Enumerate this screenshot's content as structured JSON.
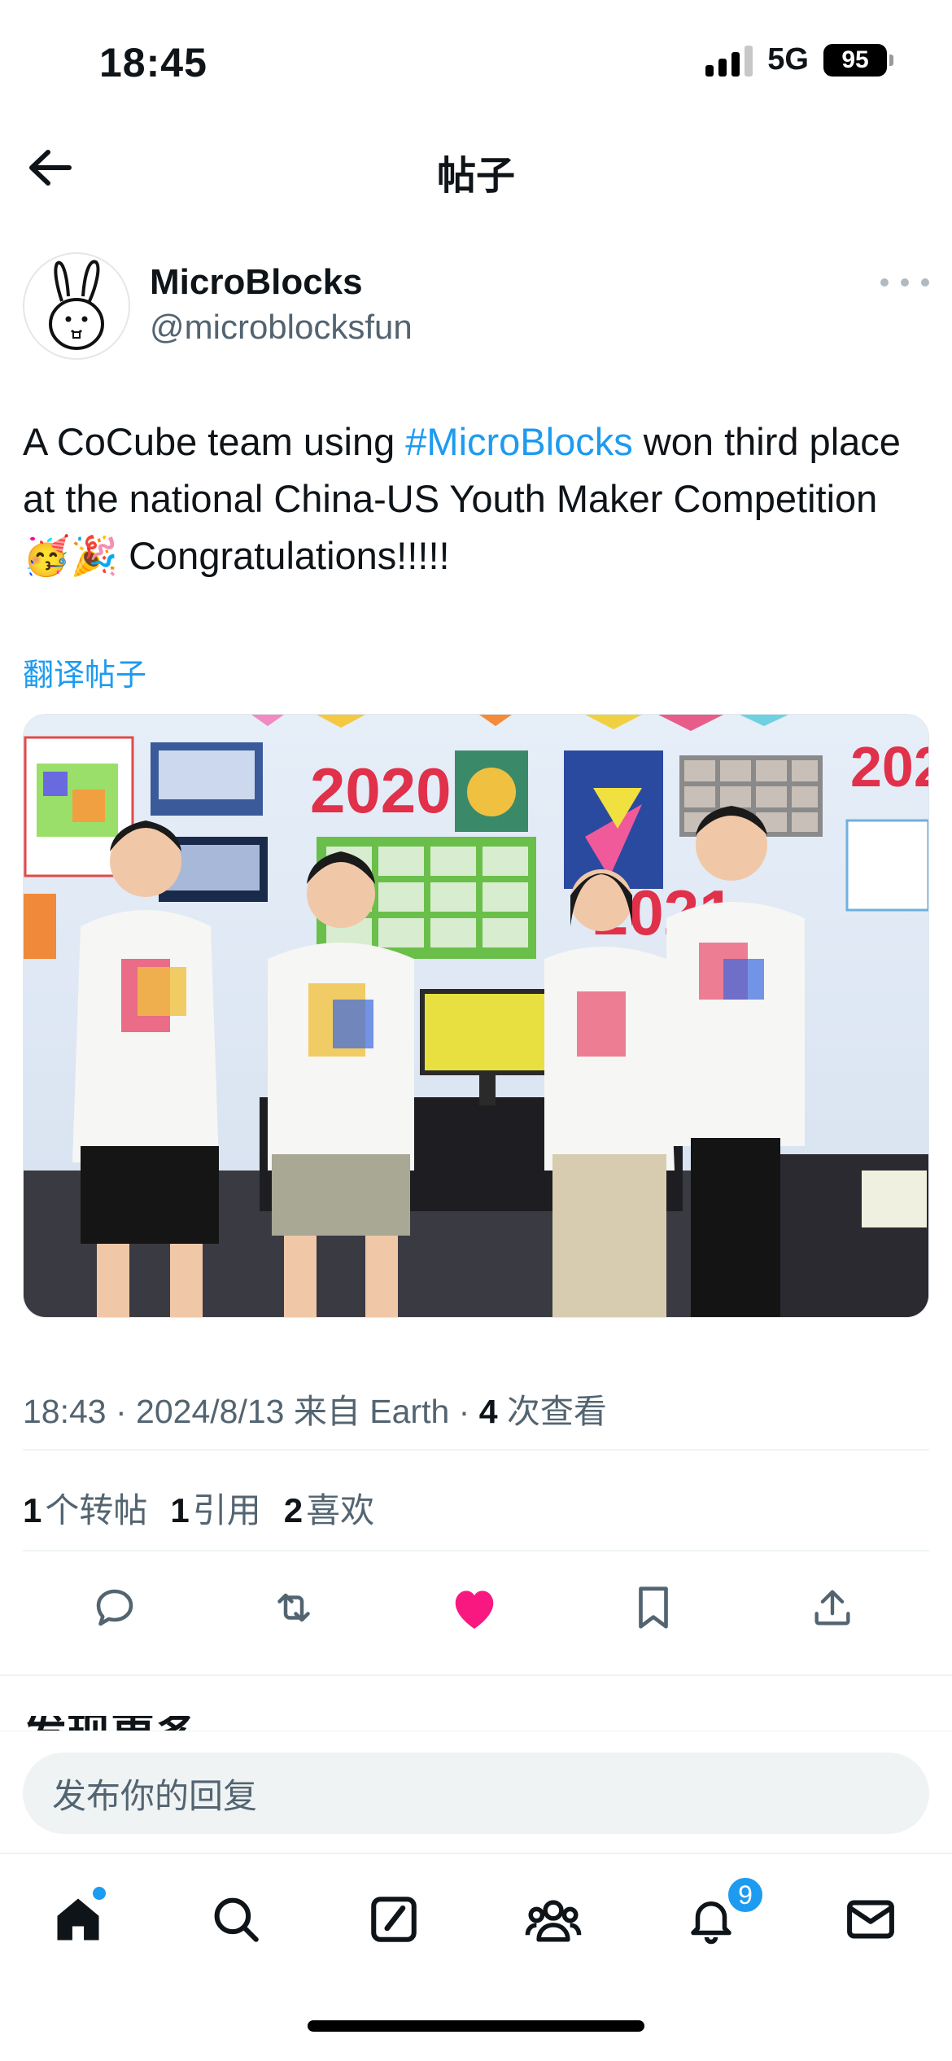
{
  "status_bar": {
    "time": "18:45",
    "network": "5G",
    "battery": "95"
  },
  "header": {
    "title": "帖子",
    "back_icon": "arrow-left-icon"
  },
  "author": {
    "name": "MicroBlocks",
    "handle": "@microblocksfun",
    "avatar_icon": "rabbit-logo"
  },
  "tweet": {
    "text_before": "A CoCube team using ",
    "hashtag": "#MicroBlocks",
    "text_after": " won third place at the national China-US Youth Maker Competition 🥳🎉 Congratulations!!!!!",
    "translate": "翻译帖子",
    "photo_text": {
      "year_a": "2020",
      "year_b": "2021",
      "year_c": "202"
    }
  },
  "meta": {
    "time": "18:43",
    "date": "2024/8/13",
    "source_prefix": "来自",
    "source": "Earth",
    "views": "4",
    "views_label": "次查看"
  },
  "stats": {
    "reposts": "1",
    "reposts_label": "个转帖",
    "quotes": "1",
    "quotes_label": "引用",
    "likes": "2",
    "likes_label": "喜欢"
  },
  "actions": {
    "reply_icon": "reply-icon",
    "repost_icon": "repost-icon",
    "like_icon": "heart-icon",
    "bookmark_icon": "bookmark-icon",
    "share_icon": "share-icon"
  },
  "section": {
    "title": "发现更多"
  },
  "reply": {
    "placeholder": "发布你的回复"
  },
  "tab_bar": {
    "notifications_badge": "9"
  },
  "colors": {
    "accent": "#1d9bf0",
    "like": "#f91880",
    "text": "#0f1419",
    "muted": "#536471"
  }
}
